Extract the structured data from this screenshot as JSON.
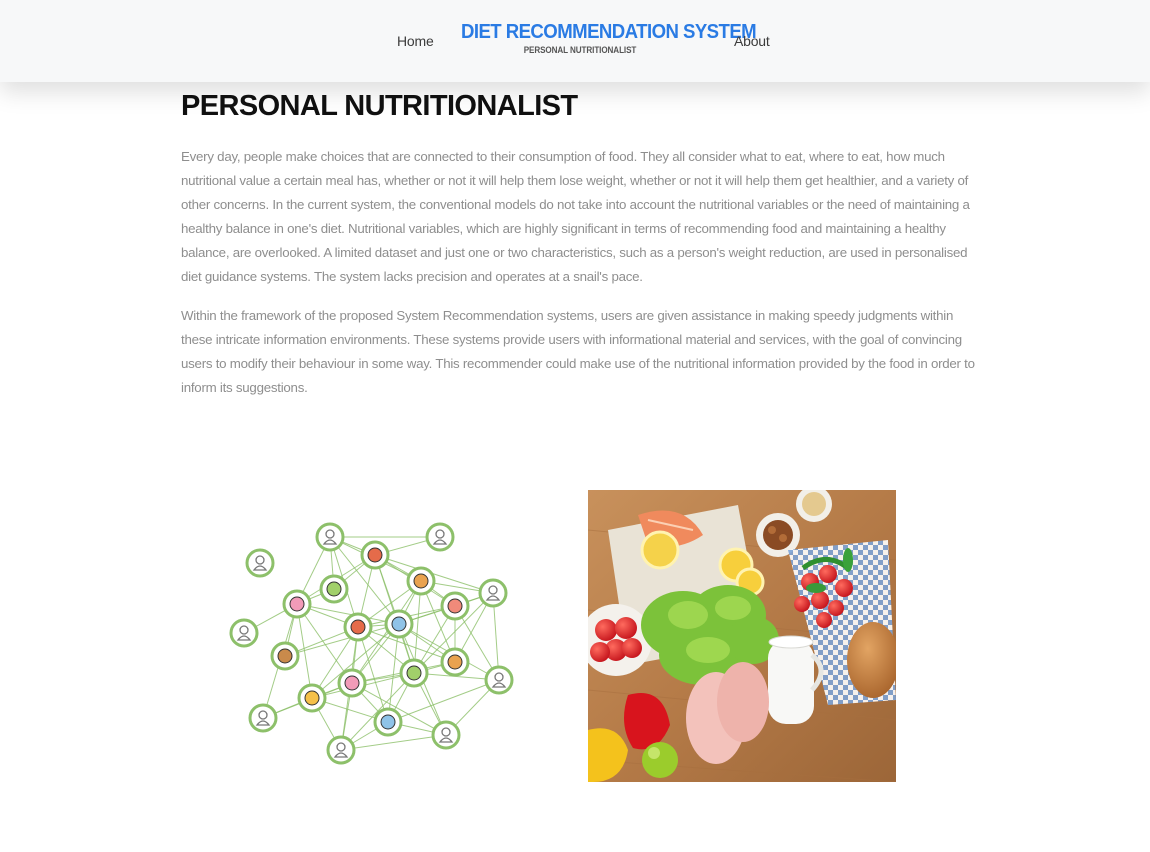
{
  "nav": {
    "home_label": "Home",
    "about_label": "About",
    "brand_title": "DIET RECOMMENDATION SYSTEM",
    "brand_subtitle": "PERSONAL NUTRITIONALIST"
  },
  "main": {
    "heading": "PERSONAL NUTRITIONALIST",
    "paragraphs": [
      "Every day, people make choices that are connected to their consumption of food. They all consider what to eat, where to eat, how much nutritional value a certain meal has, whether or not it will help them lose weight, whether or not it will help them get healthier, and a variety of other concerns. In the current system, the conventional models do not take into account the nutritional variables or the need of maintaining a healthy balance in one's diet. Nutritional variables, which are highly significant in terms of recommending food and maintaining a healthy balance, are overlooked. A limited dataset and just one or two characteristics, such as a person's weight reduction, are used in personalised diet guidance systems. The system lacks precision and operates at a snail's pace.",
      "Within the framework of the proposed System Recommendation systems, users are given assistance in making speedy judgments within these intricate information environments. These systems provide users with informational material and services, with the goal of convincing users to modify their behaviour in some way. This recommender could make use of the nutritional information provided by the food in order to inform its suggestions."
    ]
  },
  "colors": {
    "brand": "#2a7be4",
    "heading": "#111111",
    "body_text": "#8e8e8e",
    "navbar_bg": "#f7f8f9",
    "network_green": "#8dc06a"
  },
  "images": {
    "left": "user-food-network-illustration",
    "right": "healthy-food-ingredients-photo"
  }
}
